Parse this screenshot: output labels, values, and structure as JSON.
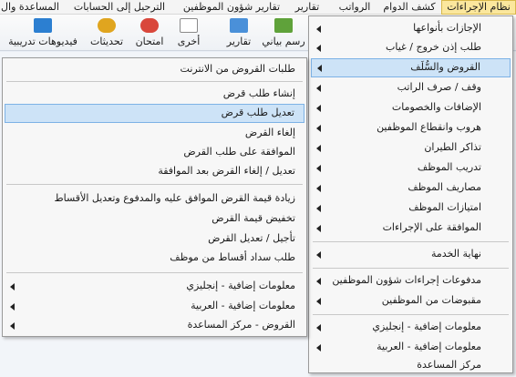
{
  "menubar": {
    "items": [
      {
        "label": "نظام الإجراءات",
        "active": true
      },
      {
        "label": "كشف الدوام"
      },
      {
        "label": "الرواتب"
      },
      {
        "label": "تقارير"
      },
      {
        "label": "تقارير شؤون الموظفين"
      },
      {
        "label": "الترحيل إلى الحسابات"
      },
      {
        "label": "المساعدة وال"
      }
    ]
  },
  "toolbar": {
    "buttons": [
      {
        "label": "فيديوهات تدريبية",
        "icon": "video-icon"
      },
      {
        "label": "تحديثات",
        "icon": "updates-icon"
      },
      {
        "label": "امتحان",
        "icon": "exam-icon"
      },
      {
        "label": "أخرى",
        "icon": "other-icon"
      },
      {
        "label": "تقارير",
        "icon": "reports-icon"
      },
      {
        "label": "رسم بياني",
        "icon": "chart-icon"
      }
    ]
  },
  "procedures_menu": {
    "items": [
      {
        "label": "الإجازات بأنواعها",
        "submenu": true
      },
      {
        "label": "طلب إذن خروج / غياب",
        "submenu": true
      },
      {
        "label": "القروض والسُّلَف",
        "submenu": true,
        "selected": true
      },
      {
        "label": "وقف / صرف الراتب",
        "submenu": true
      },
      {
        "label": "الإضافات والخصومات",
        "submenu": true
      },
      {
        "label": "هروب وانقطاع الموظفين",
        "submenu": true
      },
      {
        "label": "تذاكر الطيران",
        "submenu": true
      },
      {
        "label": "تدريب الموظف",
        "submenu": true
      },
      {
        "label": "مصاريف الموظف",
        "submenu": true
      },
      {
        "label": "امتيازات الموظف",
        "submenu": true
      },
      {
        "label": "الموافقة على الإجراءات",
        "submenu": true
      },
      {
        "label": "نهاية الخدمة",
        "submenu": true
      },
      {
        "label": "مدفوعات إجراءات شؤون الموظفين",
        "submenu": true
      },
      {
        "label": "مقبوضات من الموظفين",
        "submenu": true
      },
      {
        "label": "معلومات إضافية - إنجليزي",
        "submenu": true
      },
      {
        "label": "معلومات إضافية - العربية",
        "submenu": true
      },
      {
        "label": "مركز المساعدة",
        "submenu": false
      }
    ]
  },
  "loans_menu": {
    "items": [
      {
        "label": "طلبات القروض من الانترنت",
        "submenu": false
      },
      {
        "label": "إنشاء طلب قرض",
        "submenu": false
      },
      {
        "label": "تعديل طلب قرض",
        "submenu": false,
        "selected": true
      },
      {
        "label": "إلغاء القرض",
        "submenu": false
      },
      {
        "label": "الموافقة على طلب القرض",
        "submenu": false
      },
      {
        "label": "تعديل / إلغاء القرض بعد الموافقة",
        "submenu": false
      },
      {
        "label": "زيادة قيمة القرض الموافق عليه والمدفوع وتعديل الأقساط",
        "submenu": false
      },
      {
        "label": "تخفيض قيمة القرض",
        "submenu": false
      },
      {
        "label": "تأجيل / تعديل القرض",
        "submenu": false
      },
      {
        "label": "طلب سداد أقساط من موظف",
        "submenu": false
      },
      {
        "label": "معلومات إضافية - إنجليزي",
        "submenu": true
      },
      {
        "label": "معلومات إضافية - العربية",
        "submenu": true
      },
      {
        "label": "القروض - مركز المساعدة",
        "submenu": true
      }
    ]
  }
}
